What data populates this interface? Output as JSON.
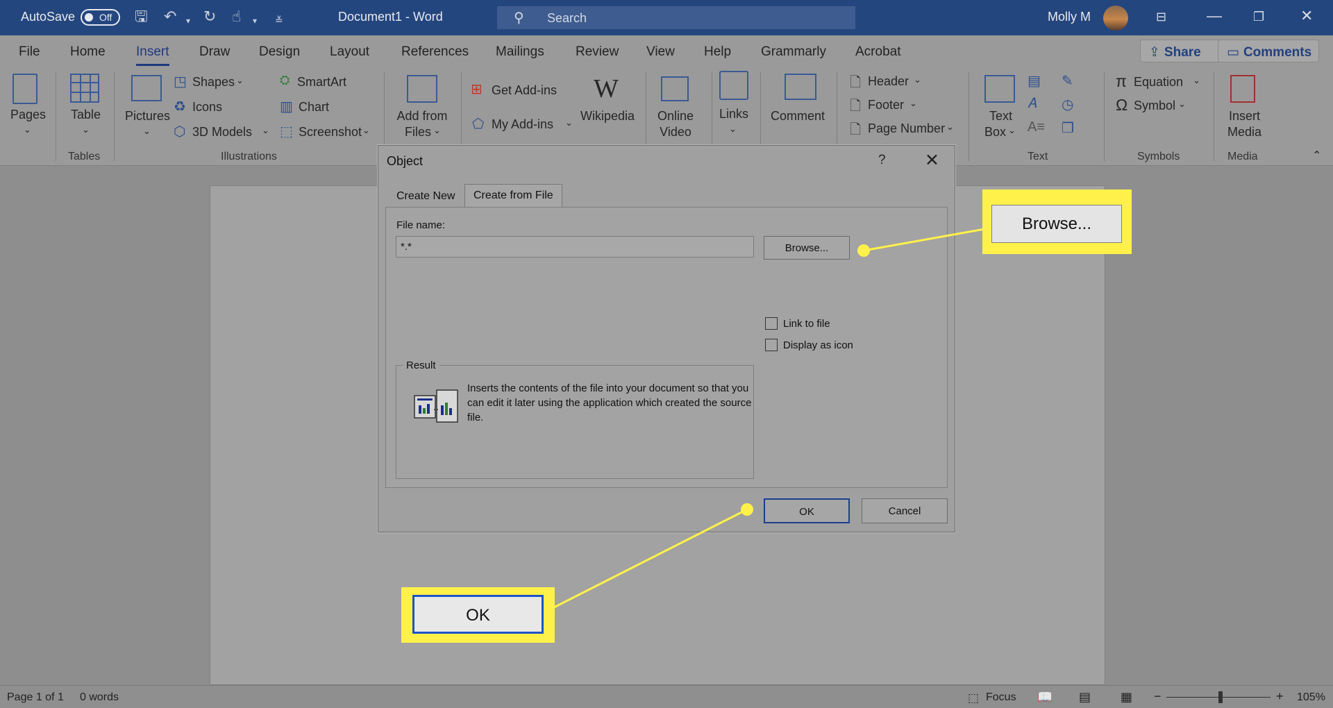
{
  "titlebar": {
    "autosave_label": "AutoSave",
    "autosave_state": "Off",
    "doc_title": "Document1  -  Word",
    "search_placeholder": "Search",
    "user_name": "Molly M"
  },
  "ribbon_tabs": [
    "File",
    "Home",
    "Insert",
    "Draw",
    "Design",
    "Layout",
    "References",
    "Mailings",
    "Review",
    "View",
    "Help",
    "Grammarly",
    "Acrobat"
  ],
  "active_tab": "Insert",
  "share_label": "Share",
  "comments_label": "Comments",
  "ribbon": {
    "pages": "Pages",
    "table": "Table",
    "group_tables": "Tables",
    "pictures": "Pictures",
    "shapes": "Shapes",
    "icons": "Icons",
    "models3d": "3D Models",
    "smartart": "SmartArt",
    "chart": "Chart",
    "screenshot": "Screenshot",
    "group_illustrations": "Illustrations",
    "add_from_files_1": "Add from",
    "add_from_files_2": "Files",
    "get_addins": "Get Add-ins",
    "my_addins": "My Add-ins",
    "wikipedia": "Wikipedia",
    "online_video_1": "Online",
    "online_video_2": "Video",
    "links": "Links",
    "comment": "Comment",
    "header": "Header",
    "footer": "Footer",
    "page_number": "Page Number",
    "text_box_1": "Text",
    "text_box_2": "Box",
    "group_text": "Text",
    "equation": "Equation",
    "symbol": "Symbol",
    "group_symbols": "Symbols",
    "insert_media_1": "Insert",
    "insert_media_2": "Media",
    "group_media": "Media"
  },
  "dialog": {
    "title": "Object",
    "help": "?",
    "tab_create_new": "Create New",
    "tab_create_from_file": "Create from File",
    "file_name_label": "File name:",
    "file_name_value": "*.*",
    "browse_label": "Browse...",
    "link_to_file": "Link to file",
    "display_as_icon": "Display as icon",
    "result_label": "Result",
    "result_text": "Inserts the contents of the file into your document so that you can edit it later using the application which created the source file.",
    "ok_label": "OK",
    "cancel_label": "Cancel"
  },
  "callouts": {
    "browse_label": "Browse...",
    "ok_label": "OK",
    "color": "#fff14a"
  },
  "status": {
    "page": "Page 1 of 1",
    "words": "0 words",
    "focus": "Focus",
    "zoom": "105%"
  }
}
